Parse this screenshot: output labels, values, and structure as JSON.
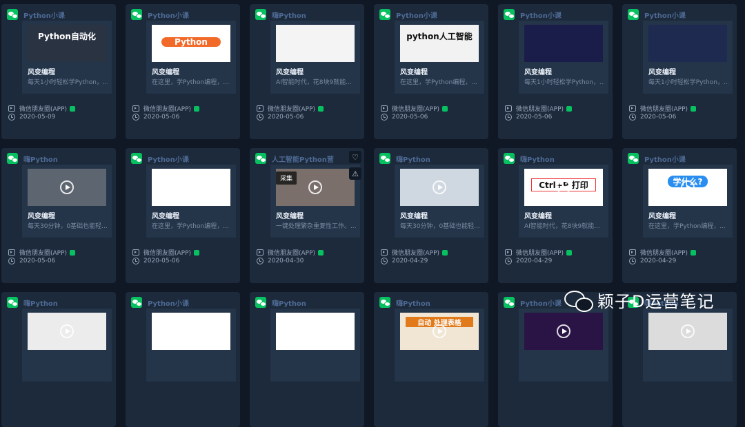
{
  "platform_label": "微信朋友圈(APP)",
  "watermark": "颖子D运营笔记",
  "actions": {
    "favorite_icon": "heart-icon",
    "report_icon": "warning-icon",
    "collect_label": "采集"
  },
  "rows": [
    [
      {
        "account": "Python小课",
        "thumb_text": "Python自动化",
        "thumb_bg": "#2a3342",
        "thumb_fg": "#ffffff",
        "title": "风变编程",
        "desc": "每天1小时轻松学Python，...",
        "date": "2020-05-09"
      },
      {
        "account": "Python小课",
        "thumb_text": "Python",
        "thumb_bg": "#ffffff",
        "thumb_fg": "#ffffff",
        "title": "风变编程",
        "desc": "在这里，学Python编程，...",
        "date": "2020-05-06"
      },
      {
        "account": "嗨Python",
        "thumb_text": "",
        "thumb_bg": "#f4f4f4",
        "thumb_fg": "#222",
        "title": "风变编程",
        "desc": "AI智能时代，花8块9就能...",
        "date": "2020-05-06"
      },
      {
        "account": "Python小课",
        "thumb_text": "python人工智能",
        "thumb_bg": "#f2f2f2",
        "thumb_fg": "#111",
        "title": "风变编程",
        "desc": "在这里，学Python编程，...",
        "date": "2020-05-06"
      },
      {
        "account": "Python小课",
        "thumb_text": "",
        "thumb_bg": "#1a1d4a",
        "thumb_fg": "#fff",
        "title": "风变编程",
        "desc": "每天1小时轻松学Python，...",
        "date": "2020-05-06"
      },
      {
        "account": "Python小课",
        "thumb_text": "",
        "thumb_bg": "#1e2a50",
        "thumb_fg": "#fff",
        "title": "风变编程",
        "desc": "每天1小时轻松学Python，...",
        "date": "2020-05-06"
      }
    ],
    [
      {
        "account": "嗨Python",
        "thumb_text": "",
        "thumb_bg": "#5d6570",
        "thumb_fg": "#fff",
        "title": "风变编程",
        "desc": "每天30分钟，0基础也能轻...",
        "date": "2020-05-06"
      },
      {
        "account": "Python小课",
        "thumb_text": "",
        "thumb_bg": "#ffffff",
        "thumb_fg": "#fff",
        "title": "风变编程",
        "desc": "在这里，学Python编程，...",
        "date": "2020-05-06"
      },
      {
        "account": "人工智能Python营",
        "thumb_text": "",
        "thumb_bg": "#7a6f6a",
        "thumb_fg": "#fff",
        "title": "风变编程",
        "desc": "一键处理繁杂重复性工作。...",
        "date": "2020-04-30"
      },
      {
        "account": "嗨Python",
        "thumb_text": "",
        "thumb_bg": "#cfd8e0",
        "thumb_fg": "#fff",
        "title": "风变编程",
        "desc": "每天30分钟，0基础也能轻...",
        "date": "2020-04-29"
      },
      {
        "account": "嗨Python",
        "thumb_text": "Ctrl+P 打印",
        "thumb_bg": "#ffffff",
        "thumb_fg": "#111",
        "title": "风变编程",
        "desc": "AI智能时代，花8块9就能...",
        "date": "2020-04-29"
      },
      {
        "account": "Python小课",
        "thumb_text": "学什么?",
        "thumb_bg": "#ffffff",
        "thumb_fg": "#fff",
        "title": "风变编程",
        "desc": "在这里，学Python编程，...",
        "date": "2020-04-29"
      }
    ],
    [
      {
        "account": "嗨Python",
        "thumb_text": "",
        "thumb_bg": "#ececec",
        "thumb_fg": "#fff",
        "title": "",
        "desc": "",
        "date": ""
      },
      {
        "account": "Python小课",
        "thumb_text": "",
        "thumb_bg": "#ffffff",
        "thumb_fg": "#fff",
        "title": "",
        "desc": "",
        "date": ""
      },
      {
        "account": "嗨Python",
        "thumb_text": "",
        "thumb_bg": "#ffffff",
        "thumb_fg": "#fff",
        "title": "",
        "desc": "",
        "date": ""
      },
      {
        "account": "嗨Python",
        "thumb_text": "自动 处理表格",
        "thumb_bg": "#f1e5d3",
        "thumb_fg": "#fff",
        "title": "",
        "desc": "",
        "date": ""
      },
      {
        "account": "Python小课",
        "thumb_text": "",
        "thumb_bg": "#2a1446",
        "thumb_fg": "#fff",
        "title": "",
        "desc": "",
        "date": ""
      },
      {
        "account": "嗨Python",
        "thumb_text": "",
        "thumb_bg": "#dcdcdc",
        "thumb_fg": "#fff",
        "title": "",
        "desc": "",
        "date": ""
      }
    ]
  ]
}
